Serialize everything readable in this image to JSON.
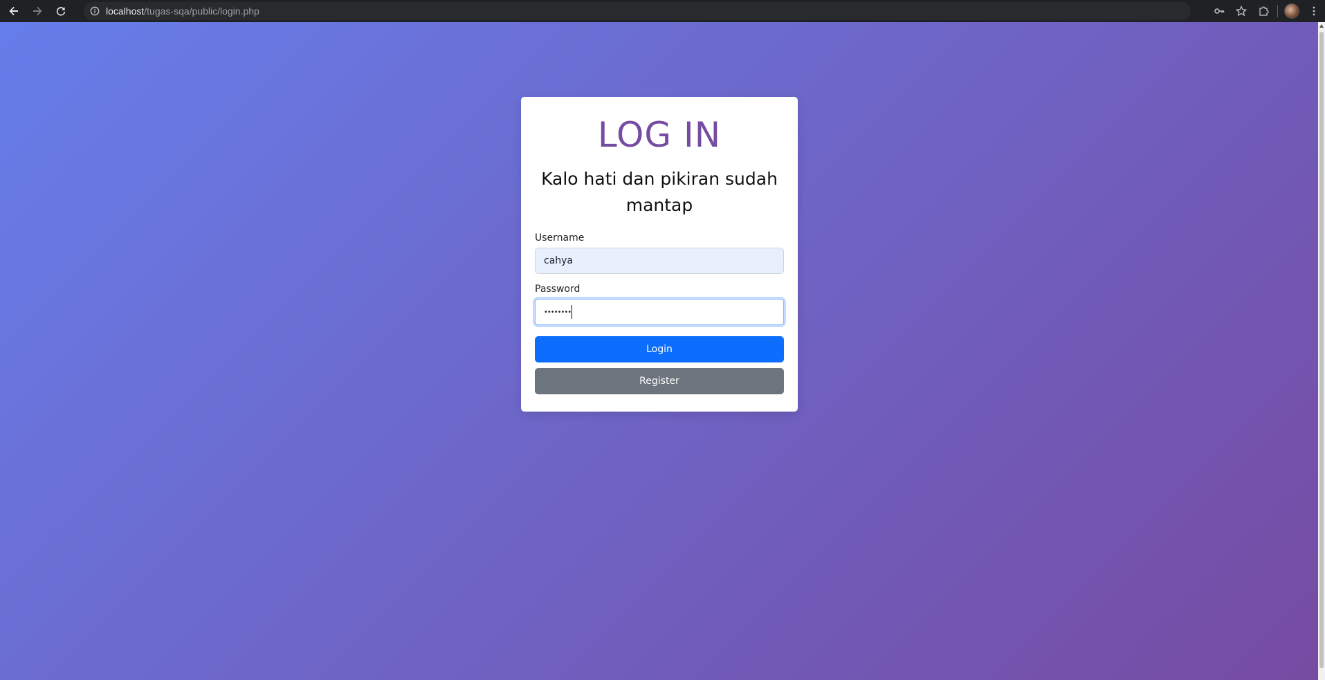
{
  "browser": {
    "url_host": "localhost",
    "url_path": "/tugas-sqa/public/login.php"
  },
  "login": {
    "title": "LOG IN",
    "tagline": "Kalo hati dan pikiran sudah mantap",
    "username_label": "Username",
    "username_value": "cahya",
    "password_label": "Password",
    "password_value": "••••••••",
    "login_button": "Login",
    "register_button": "Register"
  },
  "colors": {
    "background_start": "#667eea",
    "background_end": "#764ba2",
    "title": "#764ba2",
    "primary_button": "#0d6efd",
    "secondary_button": "#6c757d"
  },
  "icons": {
    "back": "back-arrow-icon",
    "forward": "forward-arrow-icon",
    "reload": "reload-icon",
    "site_info": "info-icon",
    "password_key": "key-icon",
    "bookmark": "star-icon",
    "extensions": "puzzle-icon",
    "profile": "avatar",
    "menu": "kebab-menu-icon"
  }
}
